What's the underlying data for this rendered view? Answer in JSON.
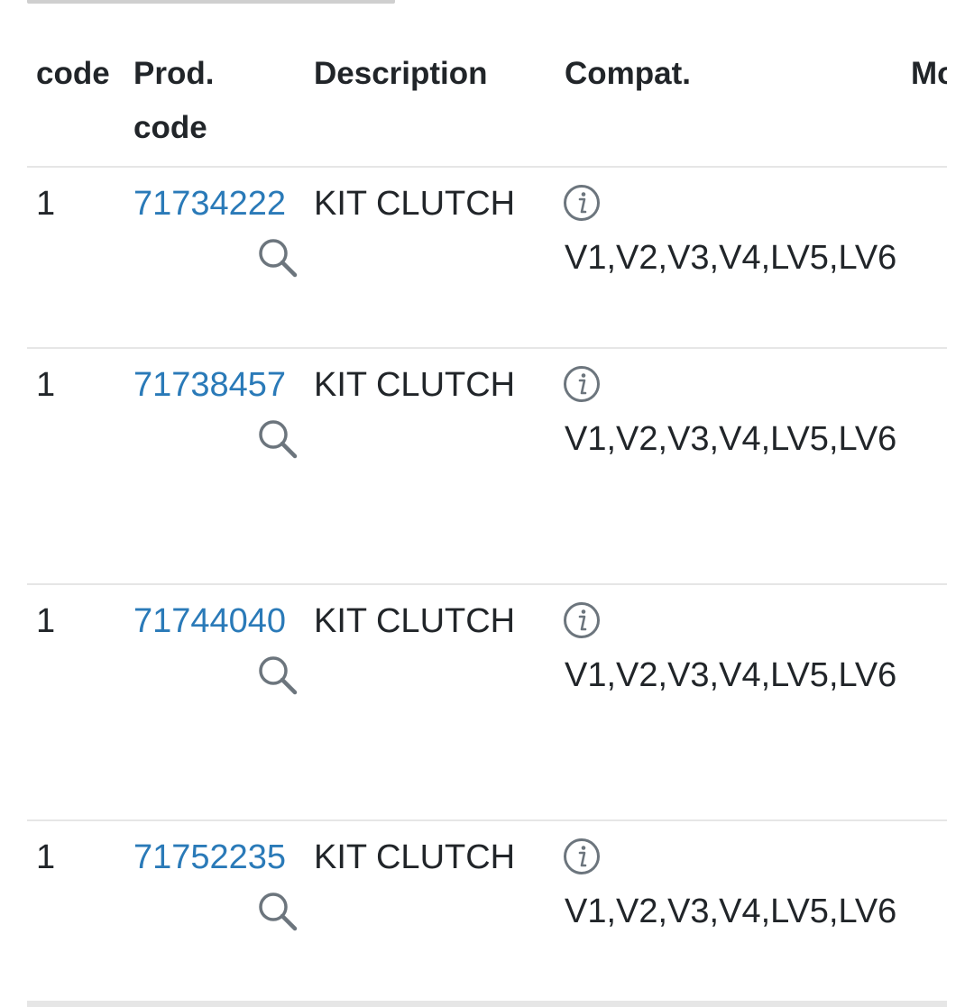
{
  "table": {
    "headers": {
      "code": "code",
      "prod_code": "Prod. code",
      "description": "Description",
      "compat": "Compat.",
      "more": "Mo"
    },
    "rows": [
      {
        "code": "1",
        "prod_code": "71734222",
        "description": "KIT CLUTCH",
        "compat": "V1,V2,V3,V4,LV5,LV6"
      },
      {
        "code": "1",
        "prod_code": "71738457",
        "description": "KIT CLUTCH",
        "compat": "V1,V2,V3,V4,LV5,LV6"
      },
      {
        "code": "1",
        "prod_code": "71744040",
        "description": "KIT CLUTCH",
        "compat": "V1,V2,V3,V4,LV5,LV6"
      },
      {
        "code": "1",
        "prod_code": "71752235",
        "description": "KIT CLUTCH",
        "compat": "V1,V2,V3,V4,LV5,LV6"
      }
    ]
  },
  "icons": {
    "search": "search-icon",
    "info": "info-icon"
  },
  "colors": {
    "link": "#2a7ab8",
    "text": "#212529",
    "divider": "#e6e6e6",
    "icon": "#6c757d"
  }
}
